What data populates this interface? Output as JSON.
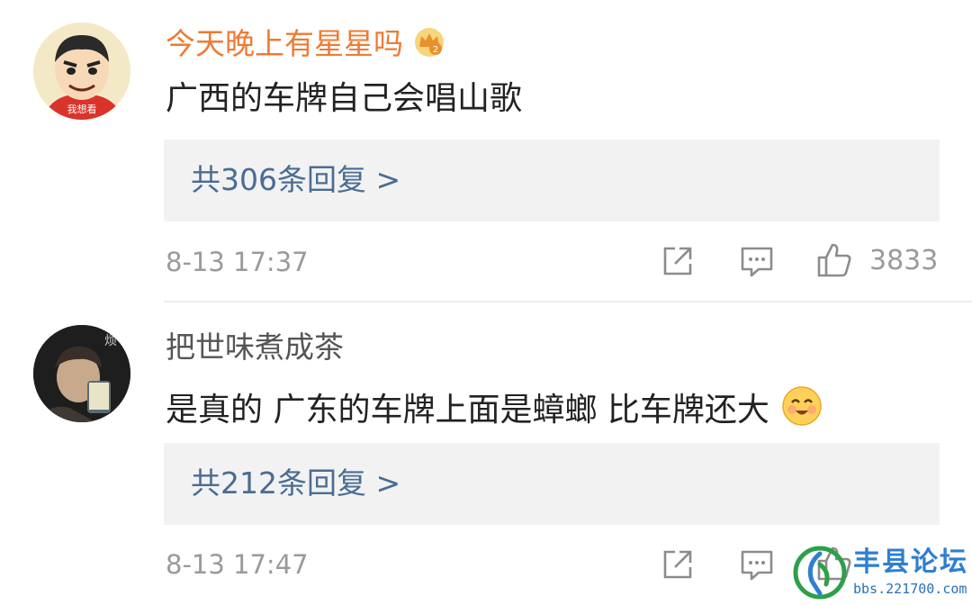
{
  "comments": [
    {
      "username": "今天晚上有星星吗",
      "vip_badge_icon": "crown-vip-2-icon",
      "text": "广西的车牌自己会唱山歌",
      "reply_link": "共306条回复 >",
      "time": "8-13 17:37",
      "like_count": "3833",
      "avatar_label": "我想看"
    },
    {
      "username": "把世味煮成茶",
      "text": "是真的 广东的车牌上面是蟑螂 比车牌还大",
      "emoji_icon": "happy-face-emoji-icon",
      "reply_link": "共212条回复 >",
      "time": "8-13 17:47",
      "avatar_label": "烦"
    }
  ],
  "watermark": {
    "title": "丰县论坛",
    "url": "bbs.221700.com"
  },
  "colors": {
    "username_vip": "#f07a32",
    "username": "#555555",
    "link": "#4a6c93",
    "meta": "#9a9a9a",
    "reply_bg": "#f2f2f2"
  }
}
